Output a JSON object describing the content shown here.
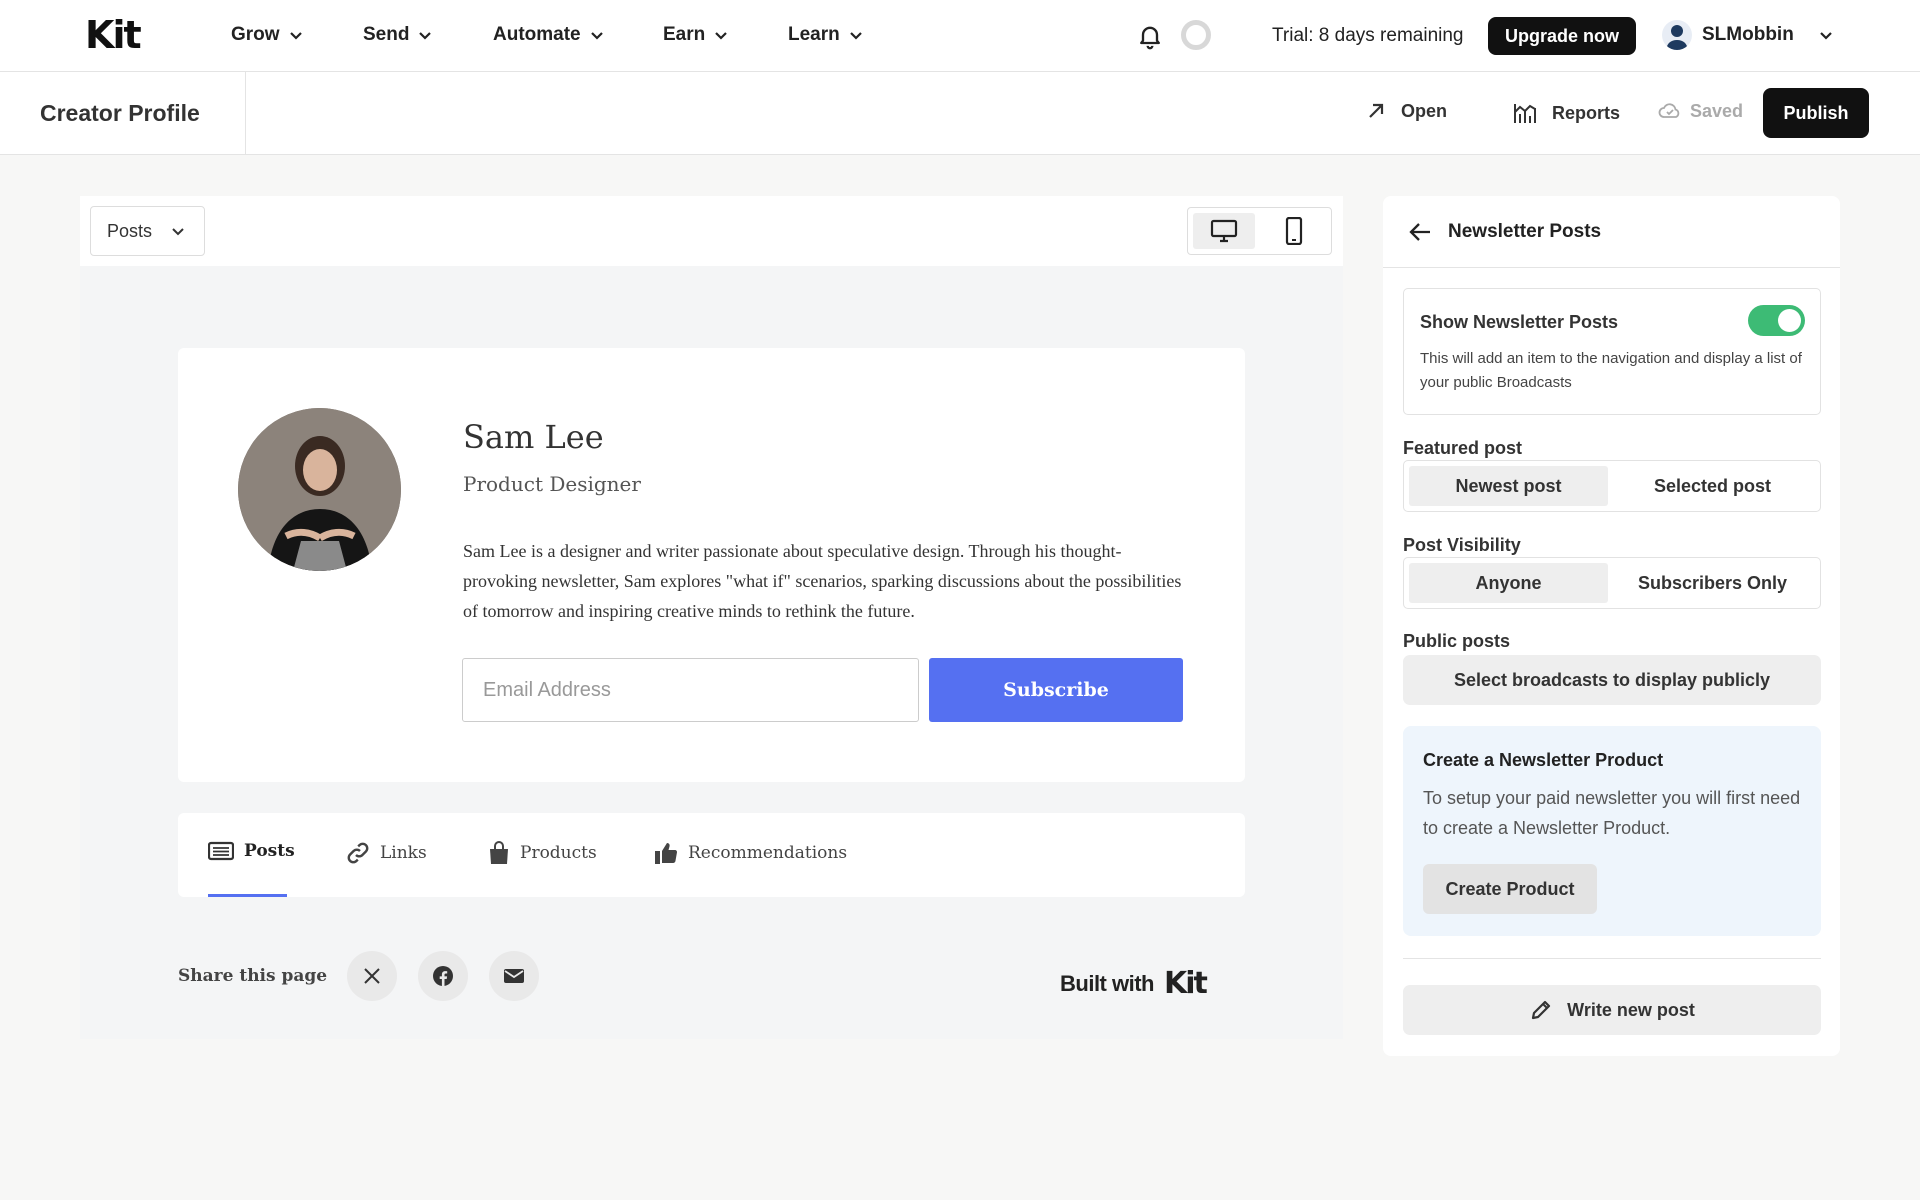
{
  "nav": {
    "logo": "Kit",
    "items": [
      {
        "label": "Grow"
      },
      {
        "label": "Send"
      },
      {
        "label": "Automate"
      },
      {
        "label": "Earn"
      },
      {
        "label": "Learn"
      }
    ],
    "trial_text": "Trial: 8 days remaining",
    "upgrade_label": "Upgrade now",
    "username": "SLMobbin"
  },
  "subheader": {
    "title": "Creator Profile",
    "open_label": "Open",
    "reports_label": "Reports",
    "saved_label": "Saved",
    "publish_label": "Publish"
  },
  "preview": {
    "section_select": "Posts",
    "device_modes": [
      "desktop",
      "mobile"
    ],
    "active_device": "desktop",
    "profile": {
      "name": "Sam Lee",
      "role": "Product Designer",
      "bio": "Sam Lee is a designer and writer passionate about speculative design. Through his thought-provoking newsletter, Sam explores \"what if\" scenarios, sparking discussions about the possibilities of tomorrow and inspiring creative minds to rethink the future.",
      "email_placeholder": "Email Address",
      "subscribe_label": "Subscribe"
    },
    "tabs": [
      {
        "label": "Posts",
        "icon": "newspaper-icon"
      },
      {
        "label": "Links",
        "icon": "link-icon"
      },
      {
        "label": "Products",
        "icon": "shopping-bag-icon"
      },
      {
        "label": "Recommendations",
        "icon": "thumbs-up-icon"
      }
    ],
    "active_tab": "Posts",
    "share_label": "Share this page",
    "share_icons": [
      "x-icon",
      "facebook-icon",
      "mail-icon"
    ],
    "built_with": "Built with",
    "built_with_brand": "Kit"
  },
  "panel": {
    "title": "Newsletter Posts",
    "show_posts": {
      "title": "Show Newsletter Posts",
      "description": "This will add an item to the navigation and display a list of your public Broadcasts",
      "enabled": true
    },
    "featured_post": {
      "label": "Featured post",
      "options": [
        "Newest post",
        "Selected post"
      ],
      "selected": "Newest post"
    },
    "post_visibility": {
      "label": "Post Visibility",
      "options": [
        "Anyone",
        "Subscribers Only"
      ],
      "selected": "Anyone"
    },
    "public_posts": {
      "label": "Public posts",
      "button": "Select broadcasts to display publicly"
    },
    "promo": {
      "title": "Create a Newsletter Product",
      "text": "To setup your paid newsletter you will first need to create a Newsletter Product.",
      "button": "Create Product"
    },
    "write_post_label": "Write new post"
  },
  "colors": {
    "accent": "#5570f1",
    "toggle_on": "#3dbb75",
    "promo_bg": "#eef5fc"
  }
}
